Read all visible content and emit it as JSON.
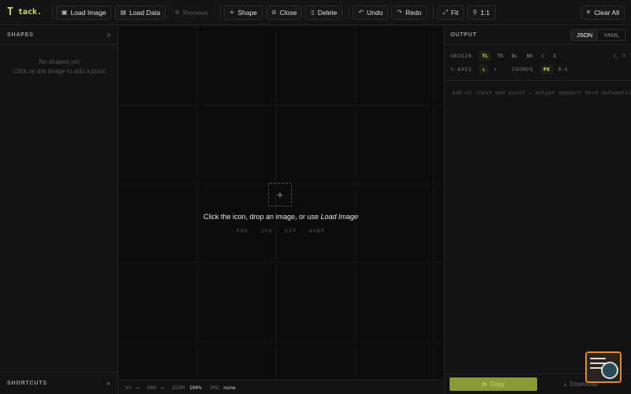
{
  "app": {
    "logo_mark": "T",
    "name": "tack."
  },
  "toolbar": {
    "load_image": "Load Image",
    "load_data": "Load Data",
    "remove": "Remove",
    "shape": "Shape",
    "close": "Close",
    "delete": "Delete",
    "undo": "Undo",
    "redo": "Redo",
    "fit": "Fit",
    "zoom_actual": "1:1",
    "clear_all": "Clear All"
  },
  "shapes_panel": {
    "title": "SHAPES",
    "count": "0",
    "empty_line1": "No shapes yet",
    "empty_line2": "Click on the image to add a point"
  },
  "shortcuts": {
    "title": "SHORTCUTS",
    "toggle": "+"
  },
  "canvas": {
    "drop_prefix": "Click the icon, drop an image, or use ",
    "drop_link": "Load Image",
    "formats": "PNG · JPG · GIF · WEBP"
  },
  "status": {
    "xy_label": "XY",
    "xy_value": "—",
    "ang_label": "ANG",
    "ang_value": "—",
    "zoom_label": "ZOOM",
    "zoom_value": "100%",
    "img_label": "IMG",
    "img_value": "none"
  },
  "output": {
    "title": "OUTPUT",
    "formats": [
      "JSON",
      "YAML"
    ],
    "active_format": "JSON",
    "origin_label": "ORIGIN",
    "origins": [
      "TL",
      "TR",
      "BL",
      "BR",
      "C",
      "E"
    ],
    "active_origin": "TL",
    "count": "0, 0",
    "yaxis_label": "Y-AXIS",
    "yaxis_options": [
      "↓",
      "↑"
    ],
    "active_yaxis": "↓",
    "coords_label": "COORDS",
    "coords_options": [
      "PX",
      "0-1"
    ],
    "active_coords": "PX",
    "placeholder": "Add at least one point — output appears here automatically",
    "copy_label": "Copy",
    "download_label": "Download"
  },
  "colors": {
    "accent": "#c8e65a",
    "copy_bg": "#899a34",
    "widget_border": "#e08a2e"
  }
}
